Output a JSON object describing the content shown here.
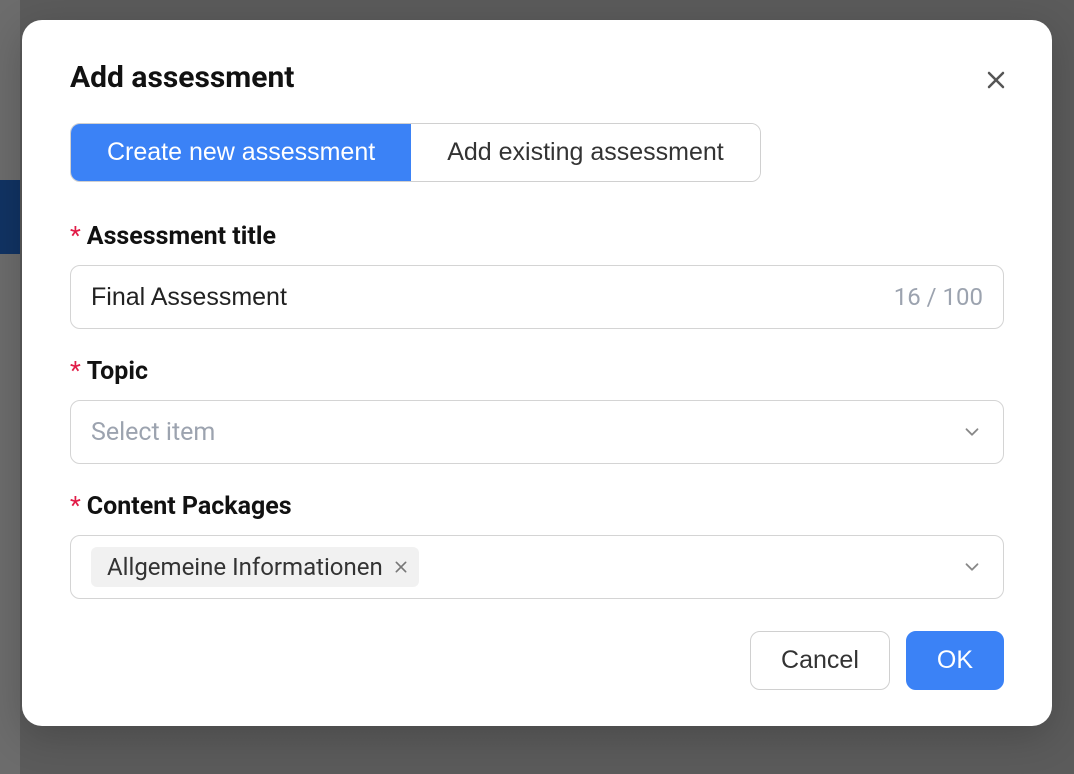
{
  "modal": {
    "title": "Add assessment",
    "tabs": {
      "create": "Create new assessment",
      "existing": "Add existing assessment"
    },
    "fields": {
      "title": {
        "label": "Assessment title",
        "value": "Final Assessment",
        "counter": "16 / 100"
      },
      "topic": {
        "label": "Topic",
        "placeholder": "Select item"
      },
      "packages": {
        "label": "Content Packages",
        "chips": [
          "Allgemeine Informationen"
        ]
      }
    },
    "buttons": {
      "cancel": "Cancel",
      "ok": "OK"
    }
  }
}
